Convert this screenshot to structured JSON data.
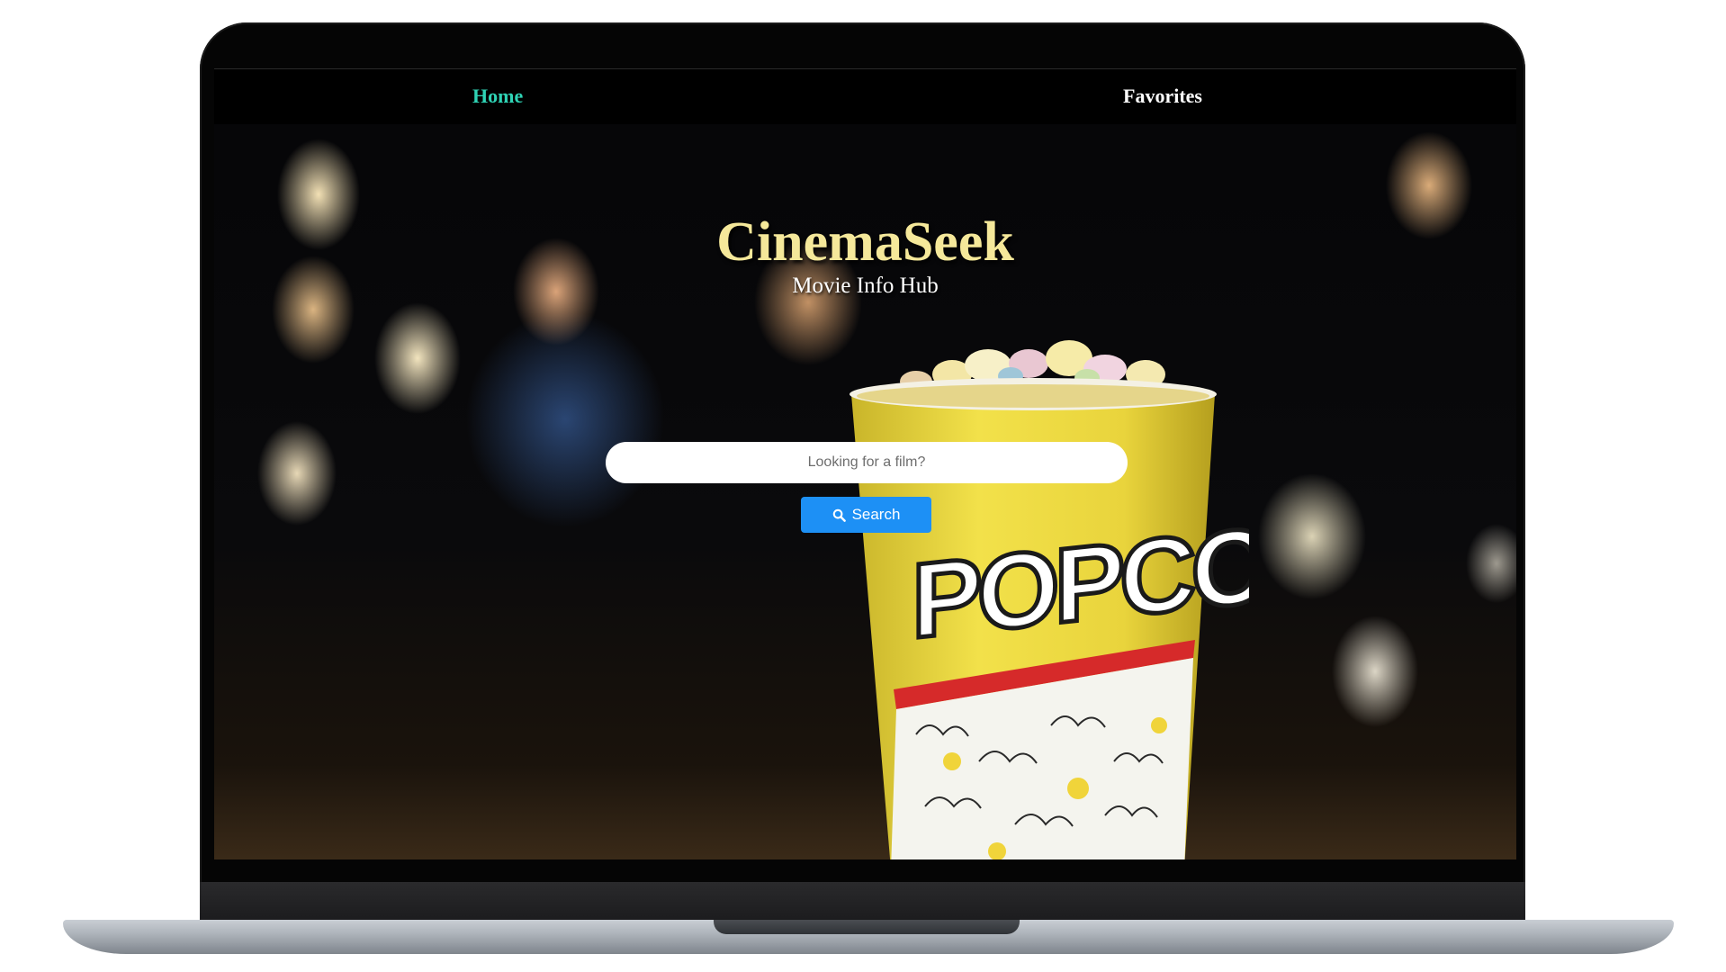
{
  "nav": {
    "home_label": "Home",
    "favorites_label": "Favorites",
    "active_color": "#2fd3b5"
  },
  "hero": {
    "title": "CinemaSeek",
    "subtitle": "Movie Info Hub",
    "title_color": "#f5e89a"
  },
  "search": {
    "placeholder": "Looking for a film?",
    "value": "",
    "button_label": "Search",
    "button_icon": "search-icon",
    "button_color": "#1d90f5"
  },
  "background": {
    "image_text": "POPCORN",
    "bucket_color": "#f2e14a",
    "stripe_color": "#d62a2a"
  }
}
